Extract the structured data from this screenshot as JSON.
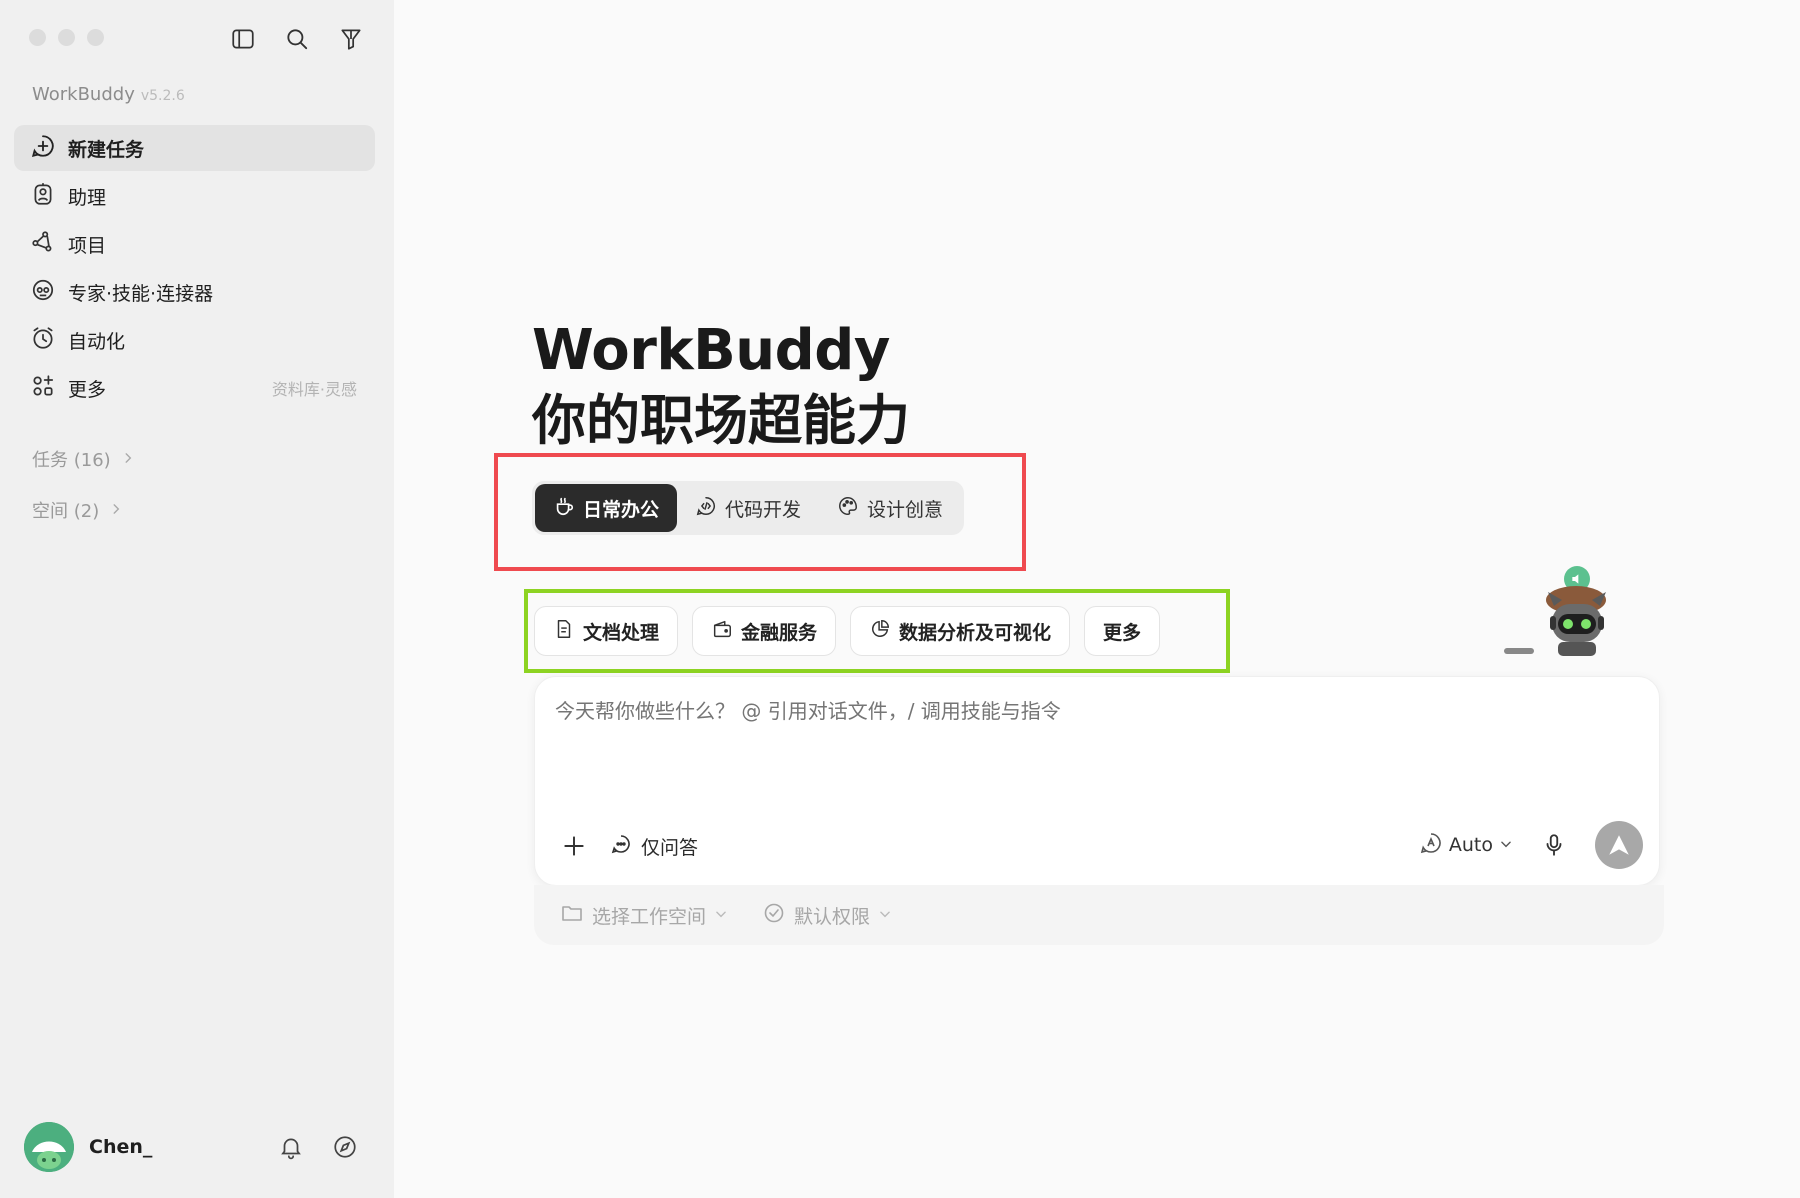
{
  "sidebar": {
    "brand": {
      "name": "WorkBuddy",
      "version": "v5.2.6"
    },
    "top_icons": [
      "sidebar-toggle-icon",
      "search-icon",
      "filter-icon"
    ],
    "items": [
      {
        "label": "新建任务",
        "icon": "new-task-icon",
        "active": true,
        "meta": ""
      },
      {
        "label": "助理",
        "icon": "assistant-icon",
        "active": false,
        "meta": ""
      },
      {
        "label": "项目",
        "icon": "project-icon",
        "active": false,
        "meta": ""
      },
      {
        "label": "专家·技能·连接器",
        "icon": "expert-icon",
        "active": false,
        "meta": ""
      },
      {
        "label": "自动化",
        "icon": "automation-icon",
        "active": false,
        "meta": ""
      },
      {
        "label": "更多",
        "icon": "more-icon",
        "active": false,
        "meta": "资料库·灵感"
      }
    ],
    "groups": [
      {
        "label": "任务 (16)"
      },
      {
        "label": "空间 (2)"
      }
    ],
    "user": {
      "name": "Chen_"
    }
  },
  "main": {
    "title": "WorkBuddy",
    "subtitle": "你的职场超能力",
    "categories": [
      {
        "label": "日常办公",
        "icon": "coffee-icon",
        "active": true
      },
      {
        "label": "代码开发",
        "icon": "code-icon",
        "active": false
      },
      {
        "label": "设计创意",
        "icon": "palette-icon",
        "active": false
      }
    ],
    "chips": [
      {
        "label": "文档处理",
        "icon": "document-icon"
      },
      {
        "label": "金融服务",
        "icon": "wallet-icon"
      },
      {
        "label": "数据分析及可视化",
        "icon": "pie-chart-icon"
      },
      {
        "label": "更多",
        "icon": ""
      }
    ],
    "input": {
      "placeholder": "今天帮你做些什么？ @ 引用对话文件，/ 调用技能与指令",
      "qa_label": "仅问答",
      "model_label": "Auto"
    },
    "under_bar": {
      "workspace_label": "选择工作空间",
      "permission_label": "默认权限"
    }
  },
  "colors": {
    "sidebar_bg": "#f0f0f0",
    "main_bg": "#fafafa",
    "active_tab": "#2b2b2b",
    "highlight_red": "#ef4a4f",
    "highlight_green": "#8dd322",
    "avatar_green": "#3f9f6e"
  }
}
